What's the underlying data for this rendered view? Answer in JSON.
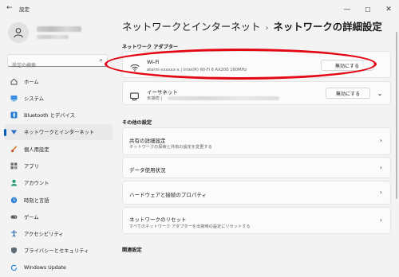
{
  "window": {
    "title": "設定",
    "back_glyph": "←",
    "minimize": "—",
    "maximize": "☐",
    "close": "✕"
  },
  "search": {
    "placeholder": "設定の検索"
  },
  "nav": [
    {
      "label": "ホーム",
      "icon": "home-icon"
    },
    {
      "label": "システム",
      "icon": "system-icon"
    },
    {
      "label": "Bluetooth とデバイス",
      "icon": "bluetooth-icon"
    },
    {
      "label": "ネットワークとインターネット",
      "icon": "network-icon",
      "active": true
    },
    {
      "label": "個人用設定",
      "icon": "brush-icon"
    },
    {
      "label": "アプリ",
      "icon": "apps-icon"
    },
    {
      "label": "アカウント",
      "icon": "account-icon"
    },
    {
      "label": "時刻と言語",
      "icon": "clock-globe-icon"
    },
    {
      "label": "ゲーム",
      "icon": "gamepad-icon"
    },
    {
      "label": "アクセシビリティ",
      "icon": "accessibility-icon"
    },
    {
      "label": "プライバシーとセキュリティ",
      "icon": "shield-icon"
    },
    {
      "label": "Windows Update",
      "icon": "update-icon"
    }
  ],
  "breadcrumb": {
    "parent": "ネットワークとインターネット",
    "separator": "›",
    "current": "ネットワークの詳細設定"
  },
  "adapters": {
    "heading": "ネットワーク アダプター",
    "wifi": {
      "name": "Wi-Fi",
      "description": "aterm-xxxxxx-x | Intel(R) Wi-Fi 6 AX200 160MHz",
      "button": "無効にする"
    },
    "ethernet": {
      "name": "イーサネット",
      "description": "未接続 |",
      "button": "無効にする",
      "expand": "⌄"
    }
  },
  "other": {
    "heading": "その他の設定",
    "items": [
      {
        "title": "共有の詳細設定",
        "subtitle": "ネットワークの探索と共有の設定を変更する"
      },
      {
        "title": "データ使用状況",
        "subtitle": ""
      },
      {
        "title": "ハードウェアと接続のプロパティ",
        "subtitle": ""
      },
      {
        "title": "ネットワークのリセット",
        "subtitle": "すべてのネットワーク アダプターを出荷時の設定にリセットする"
      }
    ]
  },
  "related": {
    "heading": "関連設定"
  },
  "colors": {
    "accent": "#005fb8",
    "annotation": "#e30613",
    "background": "#f3f3f3",
    "card": "#fbfbfb"
  },
  "chevron_glyph": "›"
}
